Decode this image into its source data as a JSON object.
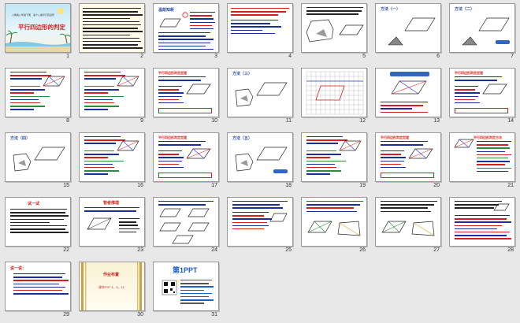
{
  "slides": [
    {
      "n": "1",
      "title": "平行四边形的判定",
      "subtitle": "人教版八年级下册　第十八章平行四边形"
    },
    {
      "n": "2",
      "title": ""
    },
    {
      "n": "3",
      "title": "温故知新"
    },
    {
      "n": "4",
      "title": ""
    },
    {
      "n": "5",
      "title": ""
    },
    {
      "n": "6",
      "title": "方法（一）"
    },
    {
      "n": "7",
      "title": "方法（二）"
    },
    {
      "n": "8",
      "title": ""
    },
    {
      "n": "9",
      "title": ""
    },
    {
      "n": "10",
      "title": "平行四边形判定定理"
    },
    {
      "n": "11",
      "title": "方法（三）"
    },
    {
      "n": "12",
      "title": ""
    },
    {
      "n": "13",
      "title": ""
    },
    {
      "n": "14",
      "title": "平行四边形判定定理"
    },
    {
      "n": "15",
      "title": "方法（四）"
    },
    {
      "n": "16",
      "title": ""
    },
    {
      "n": "17",
      "title": "平行四边形判定定理"
    },
    {
      "n": "18",
      "title": "方法（五）"
    },
    {
      "n": "19",
      "title": ""
    },
    {
      "n": "20",
      "title": "平行四边形判定定理"
    },
    {
      "n": "21",
      "title": "平行四边形判定方法"
    },
    {
      "n": "22",
      "title": "试一试"
    },
    {
      "n": "23",
      "title": "智者推理"
    },
    {
      "n": "24",
      "title": ""
    },
    {
      "n": "25",
      "title": ""
    },
    {
      "n": "26",
      "title": ""
    },
    {
      "n": "27",
      "title": ""
    },
    {
      "n": "28",
      "title": ""
    },
    {
      "n": "29",
      "title": "说一说："
    },
    {
      "n": "30",
      "title": "作业布置",
      "body": "课本P97  4、5、11"
    },
    {
      "n": "31",
      "title": "第1PPT"
    }
  ],
  "colors": {
    "slide_bg": "#ffffff",
    "blue_text": "#1b2f9a",
    "red_text": "#d41f1f",
    "title_red": "#e02020"
  }
}
